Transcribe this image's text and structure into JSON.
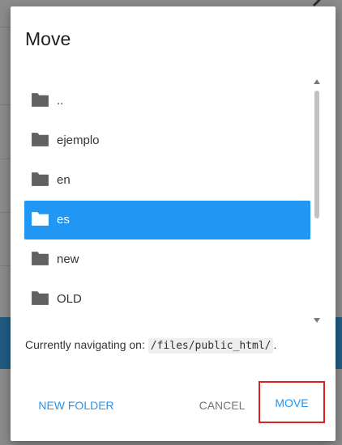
{
  "dialog": {
    "title": "Move"
  },
  "folders": [
    {
      "name": "..",
      "selected": false
    },
    {
      "name": "ejemplo",
      "selected": false
    },
    {
      "name": "en",
      "selected": false
    },
    {
      "name": "es",
      "selected": true
    },
    {
      "name": "new",
      "selected": false
    },
    {
      "name": "OLD",
      "selected": false
    }
  ],
  "navigation": {
    "label": "Currently navigating on:",
    "path": "/files/public_html/",
    "suffix": "."
  },
  "buttons": {
    "new_folder": "NEW FOLDER",
    "cancel": "CANCEL",
    "move": "MOVE"
  },
  "colors": {
    "accent": "#2196f3",
    "selected_bg": "#2196f3",
    "folder_icon": "#616161",
    "highlight_border": "#e02020",
    "backdrop_band": "#245c85"
  },
  "icons": {
    "folder": "folder-icon",
    "scroll_up": "scroll-up-arrow-icon",
    "scroll_down": "scroll-down-arrow-icon"
  }
}
